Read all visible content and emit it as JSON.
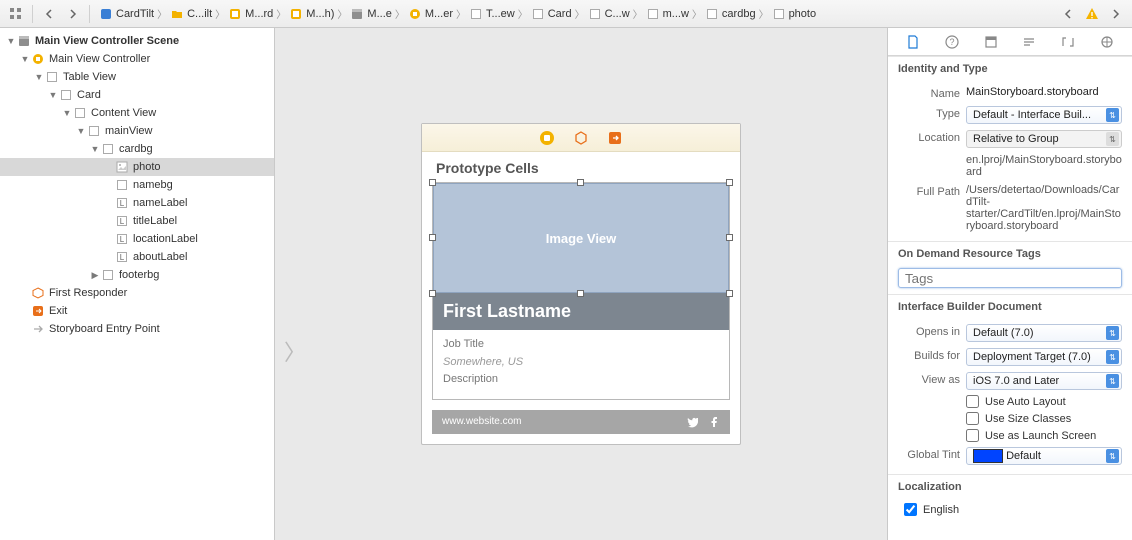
{
  "toolbar": {
    "crumbs": [
      {
        "label": "CardTilt",
        "icon": "proj-blue"
      },
      {
        "label": "C...ilt",
        "icon": "folder"
      },
      {
        "label": "M...rd",
        "icon": "storyboard"
      },
      {
        "label": "M...h)",
        "icon": "storyboard"
      },
      {
        "label": "M...e",
        "icon": "scene"
      },
      {
        "label": "M...er",
        "icon": "vc"
      },
      {
        "label": "T...ew",
        "icon": "view-g"
      },
      {
        "label": "Card",
        "icon": "view-g"
      },
      {
        "label": "C...w",
        "icon": "view-g"
      },
      {
        "label": "m...w",
        "icon": "view-g"
      },
      {
        "label": "cardbg",
        "icon": "view-g"
      },
      {
        "label": "photo",
        "icon": "view-g"
      }
    ]
  },
  "outline": {
    "items": [
      {
        "depth": 0,
        "icon": "scene",
        "label": "Main View Controller Scene",
        "disc": "▼",
        "bold": true
      },
      {
        "depth": 1,
        "icon": "vc",
        "label": "Main View Controller",
        "disc": "▼"
      },
      {
        "depth": 2,
        "icon": "view-g",
        "label": "Table View",
        "disc": "▼"
      },
      {
        "depth": 3,
        "icon": "view-g",
        "label": "Card",
        "disc": "▼"
      },
      {
        "depth": 4,
        "icon": "view-g",
        "label": "Content View",
        "disc": "▼"
      },
      {
        "depth": 5,
        "icon": "view-g",
        "label": "mainView",
        "disc": "▼"
      },
      {
        "depth": 6,
        "icon": "view-g",
        "label": "cardbg",
        "disc": "▼"
      },
      {
        "depth": 7,
        "icon": "img",
        "label": "photo",
        "disc": "",
        "sel": true
      },
      {
        "depth": 7,
        "icon": "view-g",
        "label": "namebg",
        "disc": ""
      },
      {
        "depth": 7,
        "icon": "lbl",
        "label": "nameLabel",
        "disc": ""
      },
      {
        "depth": 7,
        "icon": "lbl",
        "label": "titleLabel",
        "disc": ""
      },
      {
        "depth": 7,
        "icon": "lbl",
        "label": "locationLabel",
        "disc": ""
      },
      {
        "depth": 7,
        "icon": "lbl",
        "label": "aboutLabel",
        "disc": ""
      },
      {
        "depth": 6,
        "icon": "view-g",
        "label": "footerbg",
        "disc": "▶"
      },
      {
        "depth": 1,
        "icon": "cube",
        "label": "First Responder",
        "disc": ""
      },
      {
        "depth": 1,
        "icon": "exit",
        "label": "Exit",
        "disc": ""
      },
      {
        "depth": 1,
        "icon": "arrow",
        "label": "Storyboard Entry Point",
        "disc": ""
      }
    ]
  },
  "canvas": {
    "section": "Prototype Cells",
    "imgview": "Image View",
    "name": "First Lastname",
    "title": "Job Title",
    "location": "Somewhere, US",
    "about": "Description",
    "website": "www.website.com"
  },
  "inspector": {
    "identity_header": "Identity and Type",
    "name_k": "Name",
    "name_v": "MainStoryboard.storyboard",
    "type_k": "Type",
    "type_v": "Default - Interface Buil...",
    "location_k": "Location",
    "location_v": "Relative to Group",
    "location_path": "en.lproj/MainStoryboard.storyboard",
    "fullpath_k": "Full Path",
    "fullpath_v": "/Users/detertao/Downloads/CardTilt-starter/CardTilt/en.lproj/MainStoryboard.storyboard",
    "odr_header": "On Demand Resource Tags",
    "odr_placeholder": "Tags",
    "ibd_header": "Interface Builder Document",
    "opensin_k": "Opens in",
    "opensin_v": "Default (7.0)",
    "buildsfor_k": "Builds for",
    "buildsfor_v": "Deployment Target (7.0)",
    "viewas_k": "View as",
    "viewas_v": "iOS 7.0 and Later",
    "chk_autolayout": "Use Auto Layout",
    "chk_sizeclasses": "Use Size Classes",
    "chk_launchscreen": "Use as Launch Screen",
    "globaltint_k": "Global Tint",
    "globaltint_v": "Default",
    "loc_header": "Localization",
    "loc_english": "English"
  }
}
